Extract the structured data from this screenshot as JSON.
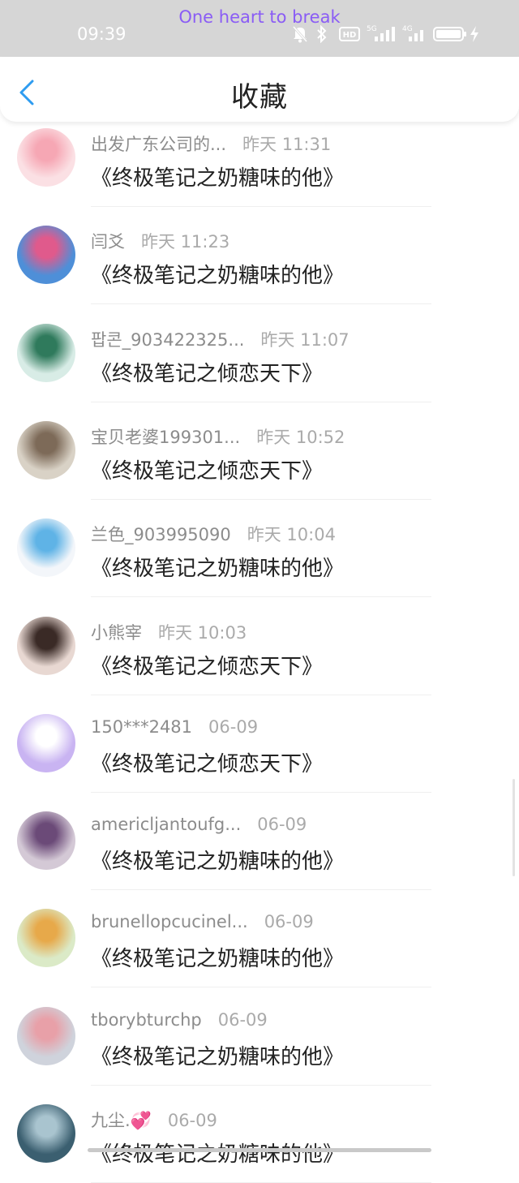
{
  "status_bar": {
    "now_playing": "One heart to break",
    "time": "09:39",
    "icons": [
      "mute-icon",
      "bluetooth-icon",
      "hd-icon",
      "5g-signal-icon",
      "4g-signal-icon",
      "battery-icon",
      "charging-icon"
    ]
  },
  "header": {
    "title": "收藏",
    "back_icon": "chevron-left-icon"
  },
  "items": [
    {
      "name": "出发广东公司的...",
      "date": "昨天 11:31",
      "book": "《终极笔记之奶糖味的他》",
      "avatar_colors": [
        "#fbe0e4",
        "#f6a7b4"
      ]
    },
    {
      "name": "闫爻",
      "date": "昨天 11:23",
      "book": "《终极笔记之奶糖味的他》",
      "avatar_colors": [
        "#4e8fd8",
        "#e05a8c"
      ]
    },
    {
      "name": "팝콘_903422325...",
      "date": "昨天 11:07",
      "book": "《终极笔记之倾恋天下》",
      "avatar_colors": [
        "#d8ece6",
        "#2f7a5c"
      ]
    },
    {
      "name": "宝贝老婆199301...",
      "date": "昨天 10:52",
      "book": "《终极笔记之倾恋天下》",
      "avatar_colors": [
        "#d9d2c6",
        "#7d6a58"
      ]
    },
    {
      "name": "兰色_903995090",
      "date": "昨天 10:04",
      "book": "《终极笔记之奶糖味的他》",
      "avatar_colors": [
        "#f3f6fa",
        "#5fb3e6"
      ]
    },
    {
      "name": "小熊宰",
      "date": "昨天 10:03",
      "book": "《终极笔记之倾恋天下》",
      "avatar_colors": [
        "#e8d8d2",
        "#3a2a26"
      ]
    },
    {
      "name": "150***2481",
      "date": "06-09",
      "book": "《终极笔记之倾恋天下》",
      "avatar_colors": [
        "#c9b4f2",
        "#ffffff"
      ]
    },
    {
      "name": "americljantoufg...",
      "date": "06-09",
      "book": "《终极笔记之奶糖味的他》",
      "avatar_colors": [
        "#d4c9d6",
        "#6b4a78"
      ]
    },
    {
      "name": "brunellopcucinel...",
      "date": "06-09",
      "book": "《终极笔记之奶糖味的他》",
      "avatar_colors": [
        "#dbeac7",
        "#e7a94a"
      ]
    },
    {
      "name": "tborybturchp",
      "date": "06-09",
      "book": "《终极笔记之奶糖味的他》",
      "avatar_colors": [
        "#cfd3dc",
        "#e8a0a8"
      ]
    },
    {
      "name": "九尘.💞",
      "date": "06-09",
      "book": "《终极笔记之奶糖味的他》",
      "avatar_colors": [
        "#3b5f70",
        "#a9c4cf"
      ]
    }
  ]
}
